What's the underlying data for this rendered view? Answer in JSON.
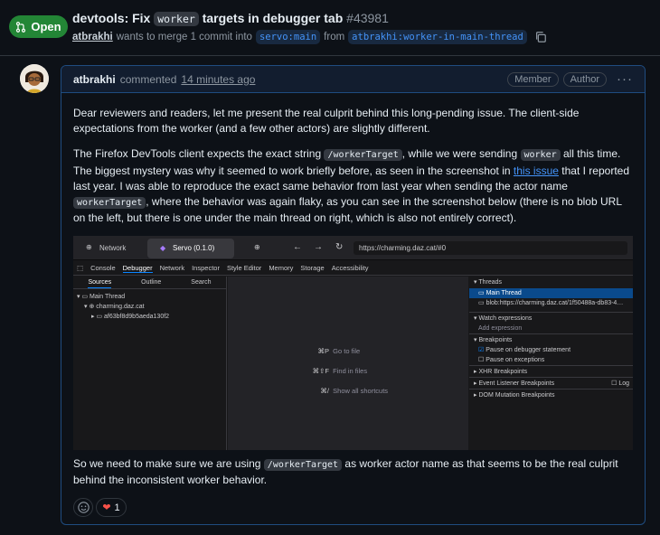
{
  "pr": {
    "state": "Open",
    "title_prefix": "devtools: Fix",
    "title_code": "worker",
    "title_suffix": "targets in debugger tab",
    "number": "#43981",
    "author": "atbrakhi",
    "meta_text": "wants to merge 1 commit into",
    "base": "servo:main",
    "from_word": "from",
    "head": "atbrakhi:worker-in-main-thread"
  },
  "comment": {
    "author": "atbrakhi",
    "action": "commented",
    "time": "14 minutes ago",
    "badges": [
      "Member",
      "Author"
    ],
    "p1": "Dear reviewers and readers, let me present the real culprit behind this long-pending issue. The client-side expectations from the worker (and a few other actors) are slightly different.",
    "p2a": "The Firefox DevTools client expects the exact string",
    "p2code1": "/workerTarget",
    "p2b": ", while we were sending",
    "p2code2": "worker",
    "p2c": "all this time.",
    "p2d": "The biggest mystery was why it seemed to work briefly before, as seen in the screenshot in",
    "p2link": "this issue",
    "p2e": "that I reported last year. I was able to reproduce the exact same behavior from last year when sending the actor name",
    "p2code3": "workerTarget",
    "p2f": ", where the behavior was again flaky, as you can see in the screenshot below (there is no blob URL on the left, but there is one under the main thread on right, which is also not entirely correct).",
    "p3a": "So we need to make sure we are using",
    "p3code": "/workerTarget",
    "p3b": "as worker actor name as that seems to be the real culprit behind the inconsistent worker behavior.",
    "reaction_count": "1"
  },
  "screenshot": {
    "tabs": [
      "Network",
      "Servo (0.1.0)"
    ],
    "url": "https://charming.daz.cat/#0",
    "devtools_tabs": [
      "Console",
      "Debugger",
      "Network",
      "Inspector",
      "Style Editor",
      "Memory",
      "Storage",
      "Accessibility"
    ],
    "left_tabs": [
      "Sources",
      "Outline",
      "Search"
    ],
    "tree": [
      "Main Thread",
      "charming.daz.cat",
      "af63bf8d9b5aeda130f2"
    ],
    "shortcuts": [
      {
        "key": "⌘P",
        "label": "Go to file"
      },
      {
        "key": "⌘⇧F",
        "label": "Find in files"
      },
      {
        "key": "⌘/",
        "label": "Show all shortcuts"
      }
    ],
    "threads_label": "Threads",
    "threads": [
      "Main Thread",
      "blob:https://charming.daz.cat/1f50488a-db83-4…"
    ],
    "watch_label": "Watch expressions",
    "add_expression": "Add expression",
    "breakpoints_label": "Breakpoints",
    "pause_debugger": "Pause on debugger statement",
    "pause_exceptions": "Pause on exceptions",
    "xhr": "XHR Breakpoints",
    "event": "Event Listener Breakpoints",
    "log": "Log",
    "dom": "DOM Mutation Breakpoints"
  }
}
